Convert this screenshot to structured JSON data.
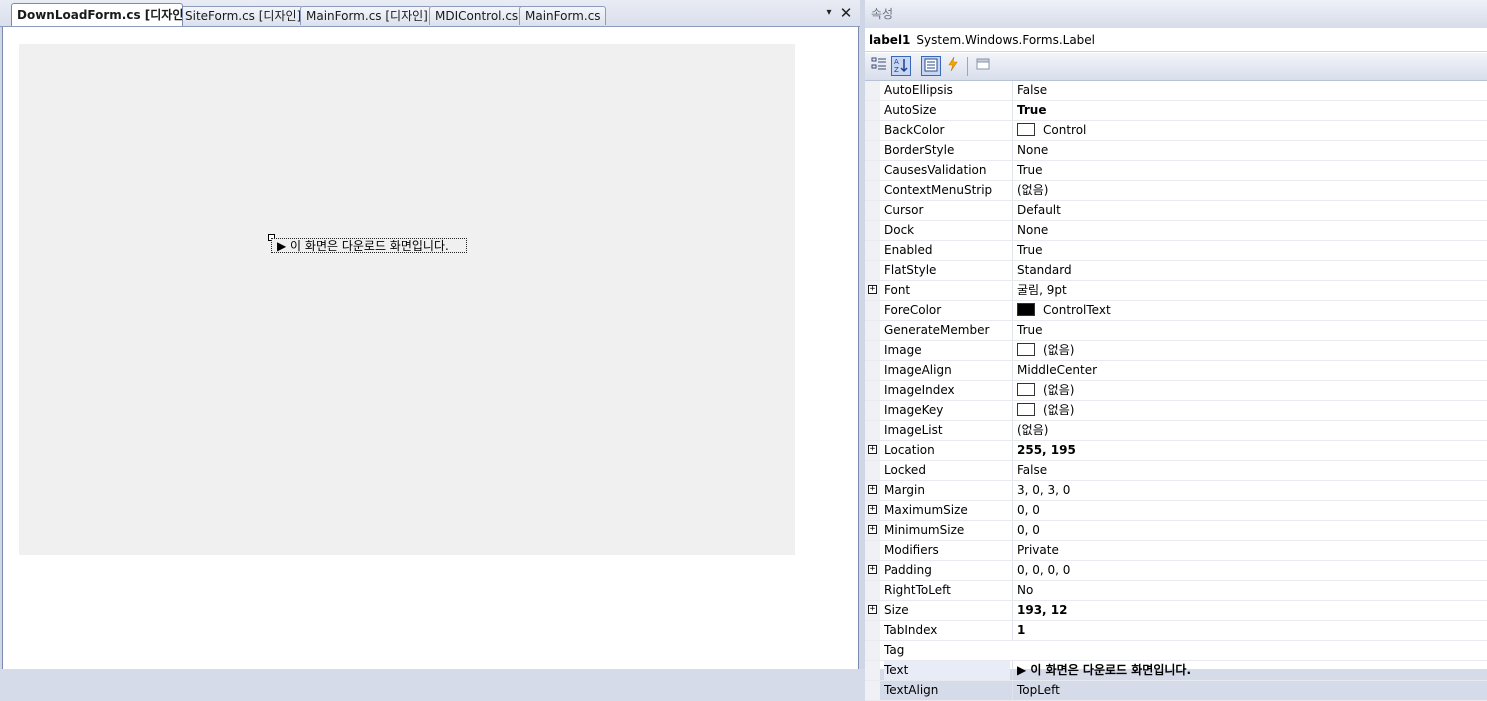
{
  "tabs": [
    {
      "label": "DownLoadForm.cs [디자인]*",
      "active": true
    },
    {
      "label": "SiteForm.cs [디자인]",
      "active": false
    },
    {
      "label": "MainForm.cs [디자인]",
      "active": false
    },
    {
      "label": "MDIControl.cs",
      "active": false
    },
    {
      "label": "MainForm.cs",
      "active": false
    }
  ],
  "tab_controls": {
    "dropdown": "▾",
    "close": "✕"
  },
  "designer": {
    "label_text": "▶ 이 화면은 다운로드 화면입니다."
  },
  "properties": {
    "title": "속성",
    "object_name": "label1",
    "object_type": "System.Windows.Forms.Label",
    "toolbar": {
      "categorized_icon": "categorized-icon",
      "alphabetical_icon": "alphabetical-icon",
      "properties_icon": "properties-icon",
      "events_icon": "lightning-icon",
      "property_pages_icon": "property-pages-icon"
    },
    "rows": [
      {
        "name": "AutoEllipsis",
        "value": "False"
      },
      {
        "name": "AutoSize",
        "value": "True",
        "bold": true
      },
      {
        "name": "BackColor",
        "value": "Control",
        "swatch": "#ffffff"
      },
      {
        "name": "BorderStyle",
        "value": "None"
      },
      {
        "name": "CausesValidation",
        "value": "True"
      },
      {
        "name": "ContextMenuStrip",
        "value": "(없음)"
      },
      {
        "name": "Cursor",
        "value": "Default"
      },
      {
        "name": "Dock",
        "value": "None"
      },
      {
        "name": "Enabled",
        "value": "True"
      },
      {
        "name": "FlatStyle",
        "value": "Standard"
      },
      {
        "name": "Font",
        "value": "굴림, 9pt",
        "expand": true
      },
      {
        "name": "ForeColor",
        "value": "ControlText",
        "swatch": "#000000"
      },
      {
        "name": "GenerateMember",
        "value": "True"
      },
      {
        "name": "Image",
        "value": "(없음)",
        "swatch": "#ffffff"
      },
      {
        "name": "ImageAlign",
        "value": "MiddleCenter"
      },
      {
        "name": "ImageIndex",
        "value": "(없음)",
        "swatch": "#ffffff"
      },
      {
        "name": "ImageKey",
        "value": "(없음)",
        "swatch": "#ffffff"
      },
      {
        "name": "ImageList",
        "value": "(없음)"
      },
      {
        "name": "Location",
        "value": "255, 195",
        "bold": true,
        "expand": true
      },
      {
        "name": "Locked",
        "value": "False"
      },
      {
        "name": "Margin",
        "value": "3, 0, 3, 0",
        "expand": true
      },
      {
        "name": "MaximumSize",
        "value": "0, 0",
        "expand": true
      },
      {
        "name": "MinimumSize",
        "value": "0, 0",
        "expand": true
      },
      {
        "name": "Modifiers",
        "value": "Private"
      },
      {
        "name": "Padding",
        "value": "0, 0, 0, 0",
        "expand": true
      },
      {
        "name": "RightToLeft",
        "value": "No"
      },
      {
        "name": "Size",
        "value": "193, 12",
        "bold": true,
        "expand": true
      },
      {
        "name": "TabIndex",
        "value": "1",
        "bold": true
      },
      {
        "name": "Tag",
        "value": ""
      },
      {
        "name": "Text",
        "value": "▶ 이 화면은 다운로드 화면입니다.",
        "bold": true,
        "selected": true
      },
      {
        "name": "TextAlign",
        "value": "TopLeft"
      }
    ]
  }
}
